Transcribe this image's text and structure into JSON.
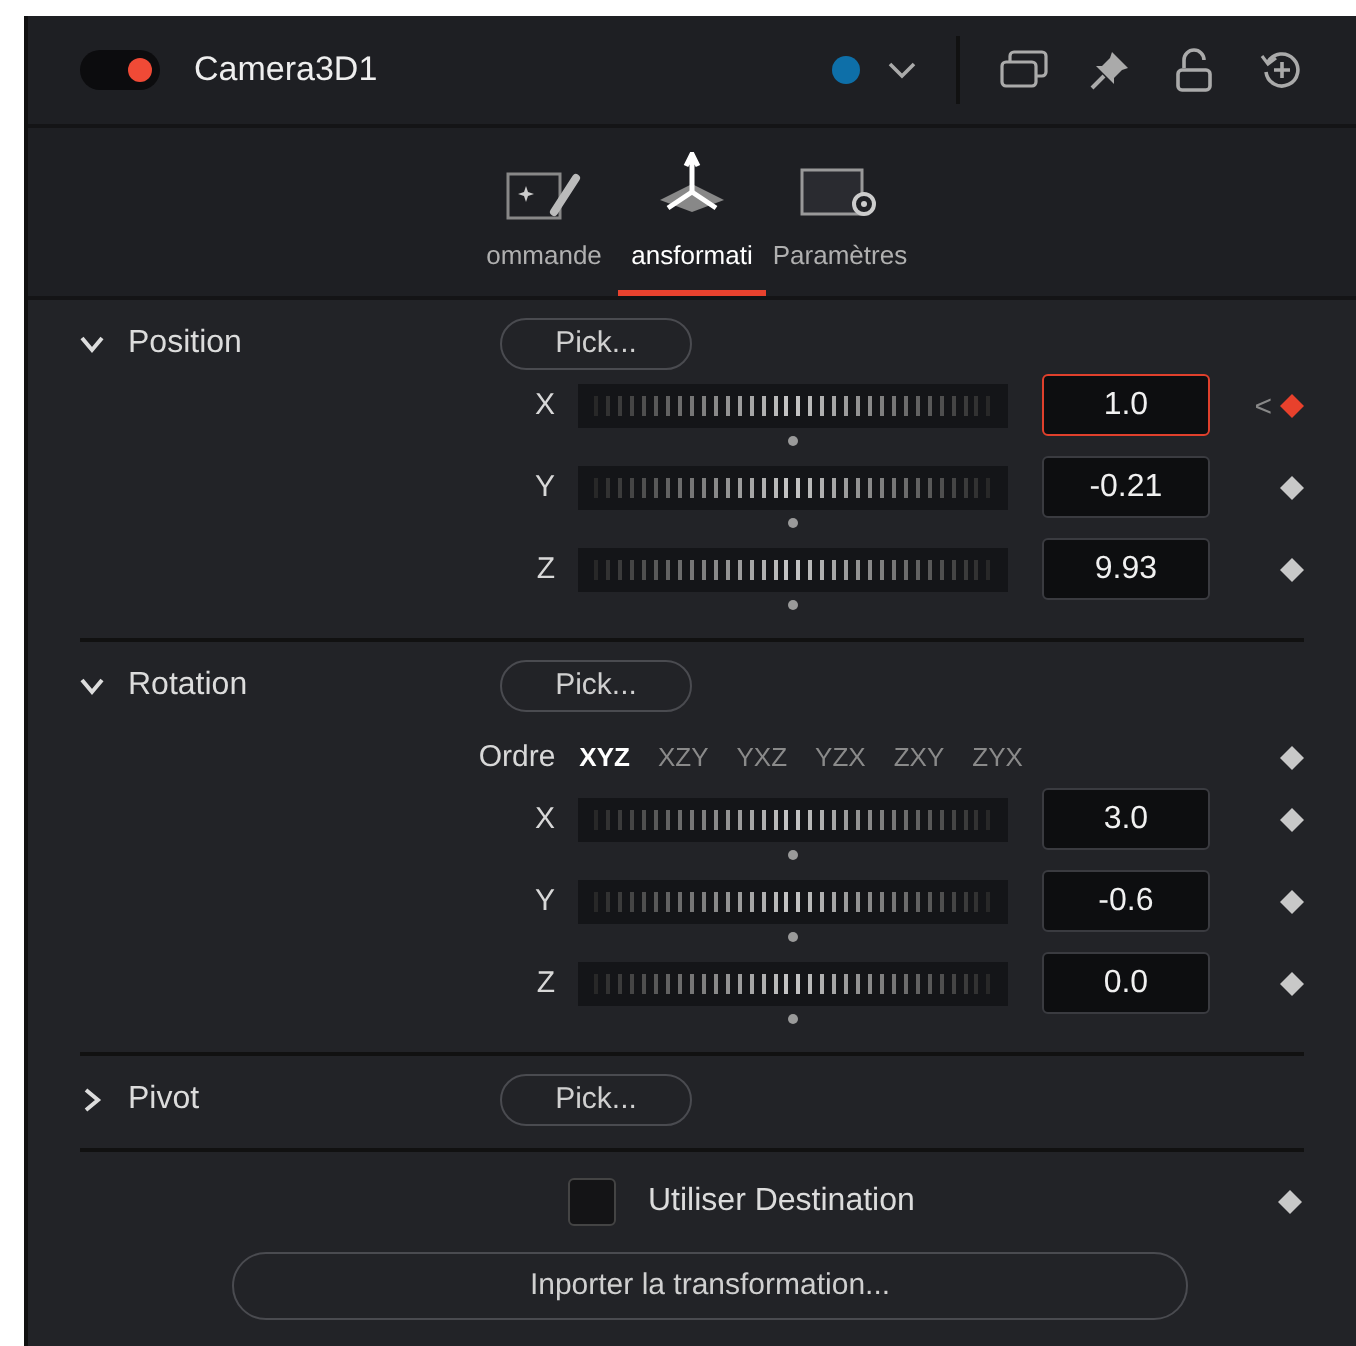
{
  "node": {
    "title": "Camera3D1",
    "enabled": true,
    "color": "#0e6fa8"
  },
  "tabs": [
    {
      "label": "ommande",
      "selected": false,
      "kind": "controls"
    },
    {
      "label": "ansformati",
      "selected": true,
      "kind": "transform"
    },
    {
      "label": "Paramètres",
      "selected": false,
      "kind": "settings"
    }
  ],
  "sections": [
    {
      "title": "Position",
      "expanded": true,
      "pick": "Pick...",
      "rows": [
        {
          "kind": "axis",
          "axis": "X",
          "level": 0.5,
          "value": "1.0",
          "focused": true,
          "keyed": true,
          "prev_key": "<"
        },
        {
          "kind": "axis",
          "axis": "Y",
          "level": 0.5,
          "value": "-0.21",
          "focused": false,
          "keyed": false
        },
        {
          "kind": "axis",
          "axis": "Z",
          "level": 0.5,
          "value": "9.93",
          "focused": false,
          "keyed": false
        }
      ]
    },
    {
      "title": "Rotation",
      "expanded": true,
      "pick": "Pick...",
      "rows": [
        {
          "kind": "order",
          "label": "Ordre",
          "keyed": false,
          "options": [
            {
              "label": "XYZ",
              "selected": true
            },
            {
              "label": "XZY",
              "selected": false
            },
            {
              "label": "YXZ",
              "selected": false
            },
            {
              "label": "YZX",
              "selected": false
            },
            {
              "label": "ZXY",
              "selected": false
            },
            {
              "label": "ZYX",
              "selected": false
            }
          ]
        },
        {
          "kind": "axis",
          "axis": "X",
          "level": 0.5,
          "value": "3.0",
          "focused": false,
          "keyed": false
        },
        {
          "kind": "axis",
          "axis": "Y",
          "level": 0.5,
          "value": "-0.6",
          "focused": false,
          "keyed": false
        },
        {
          "kind": "axis",
          "axis": "Z",
          "level": 0.5,
          "value": "0.0",
          "focused": false,
          "keyed": false
        }
      ]
    },
    {
      "title": "Pivot",
      "expanded": false,
      "pick": "Pick..."
    }
  ],
  "use_target": {
    "label": "Utiliser Destination",
    "checked": false,
    "keyed": false
  },
  "import_button": "Inporter la transformation..."
}
